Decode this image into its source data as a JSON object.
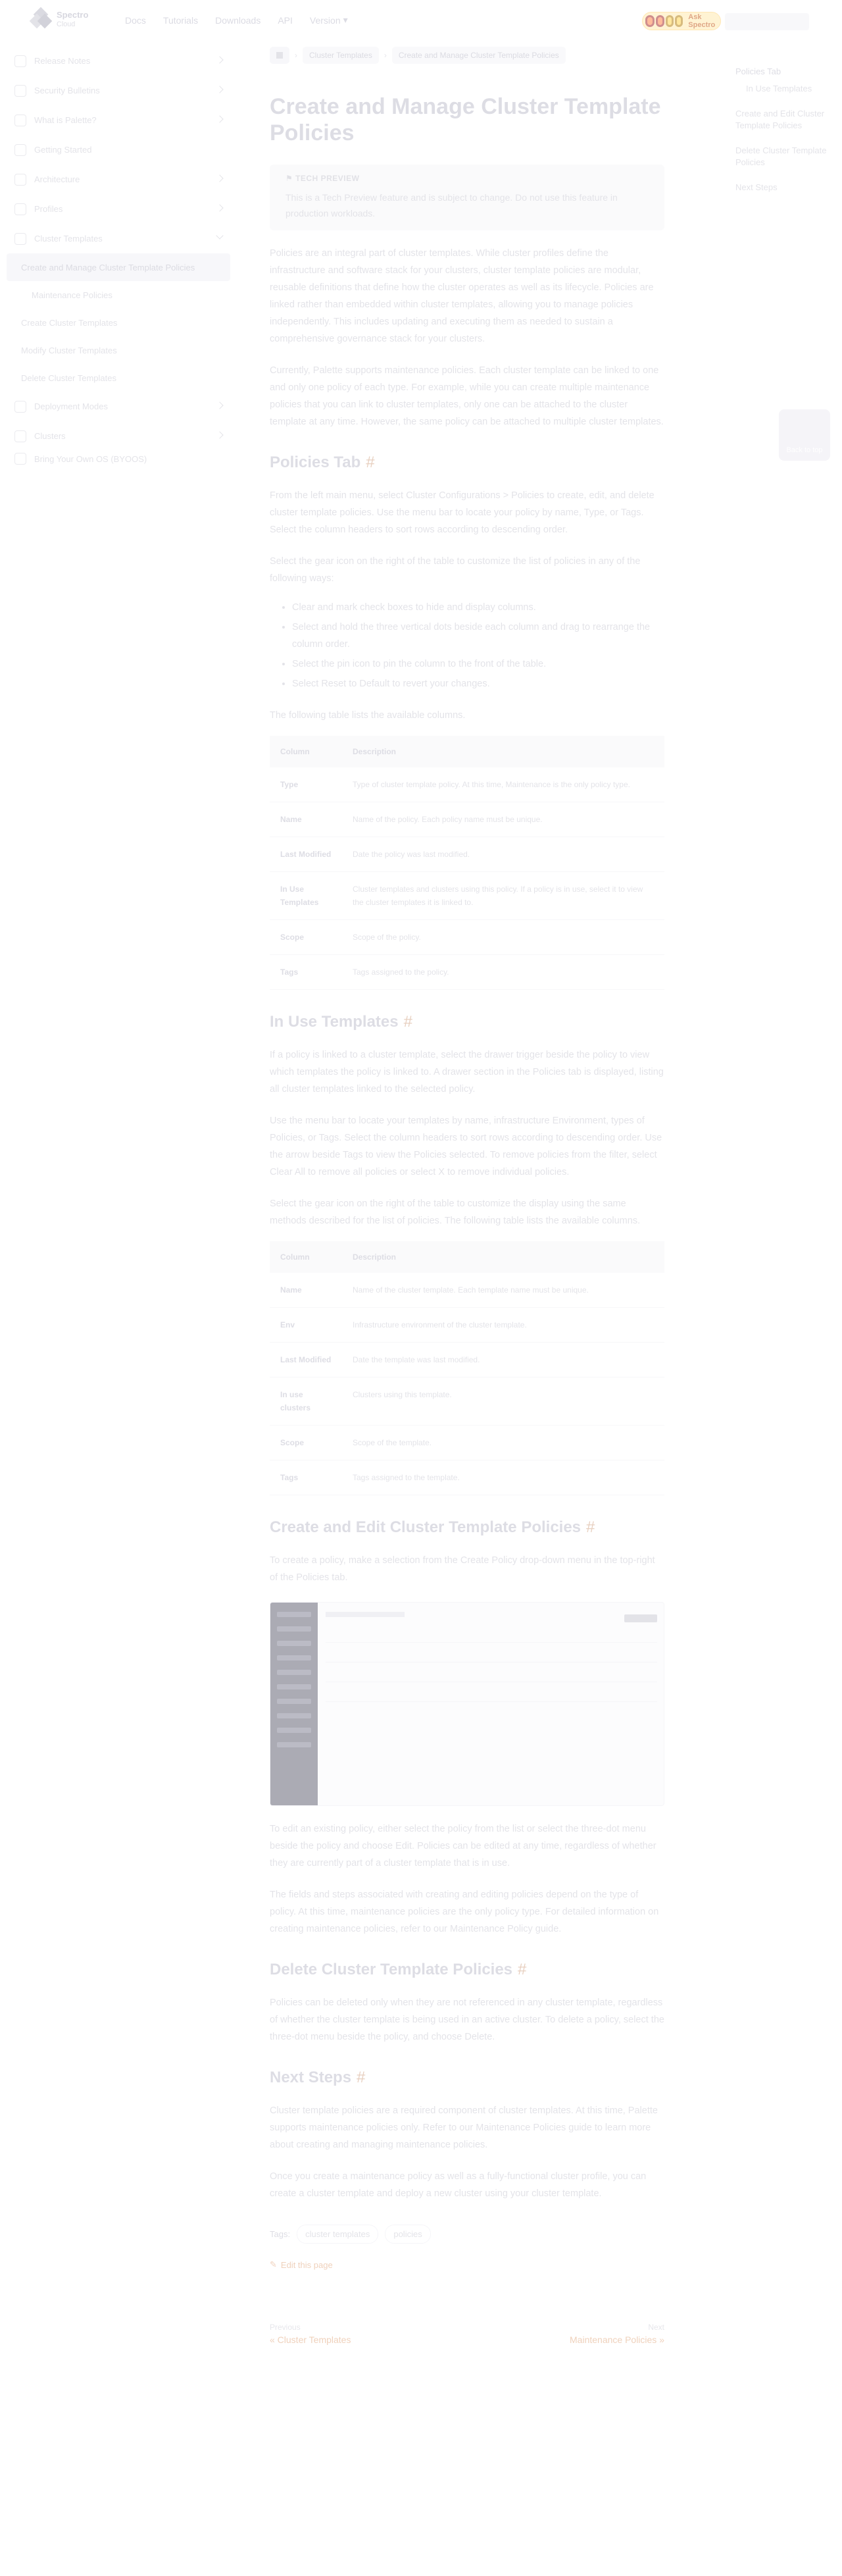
{
  "nav": {
    "logo_top": "Spectro",
    "logo_bottom": "Cloud",
    "links": [
      "Docs",
      "Tutorials",
      "Downloads",
      "API",
      "Version"
    ],
    "ask_label": "Ask Spectro"
  },
  "sidebar": {
    "items": [
      {
        "label": "Release Notes",
        "expand": true
      },
      {
        "label": "Security Bulletins",
        "expand": true
      },
      {
        "label": "What is Palette?",
        "expand": true
      },
      {
        "label": "Getting Started",
        "expand": false
      },
      {
        "label": "Architecture",
        "expand": true
      },
      {
        "label": "Profiles",
        "expand": true
      },
      {
        "label": "Cluster Templates",
        "expand": true,
        "open": true
      }
    ],
    "active_sub": "Create and Manage Cluster Template Policies",
    "subsub": "Maintenance Policies",
    "subs_after": [
      "Create Cluster Templates",
      "Modify Cluster Templates",
      "Delete Cluster Templates"
    ],
    "items_after": [
      {
        "label": "Deployment Modes",
        "expand": true
      },
      {
        "label": "Clusters",
        "expand": true
      },
      {
        "label": "Bring Your Own OS (BYOOS)",
        "expand": true
      }
    ]
  },
  "breadcrumb": {
    "items": [
      "Cluster Templates",
      "Create and Manage Cluster Template Policies"
    ]
  },
  "page": {
    "title": "Create and Manage Cluster Template Policies",
    "callout_title": "TECH PREVIEW",
    "callout_text": "This is a Tech Preview feature and is subject to change. Do not use this feature in production workloads.",
    "intro_1": "Policies are an integral part of cluster templates. While cluster profiles define the infrastructure and software stack for your clusters, cluster template policies are modular, reusable definitions that define how the cluster operates as well as its lifecycle. Policies are linked rather than embedded within cluster templates, allowing you to manage policies independently. This includes updating and executing them as needed to sustain a comprehensive governance stack for your clusters.",
    "intro_2": "Currently, Palette supports maintenance policies. Each cluster template can be linked to one and only one policy of each type. For example, while you can create multiple maintenance policies that you can link to cluster templates, only one can be attached to the cluster template at any time. However, the same policy can be attached to multiple cluster templates.",
    "h_policies_tab": "Policies Tab",
    "policies_tab_1": "From the left main menu, select Cluster Configurations > Policies to create, edit, and delete cluster template policies. Use the menu bar to locate your policy by name, Type, or Tags. Select the column headers to sort rows according to descending order.",
    "policies_tab_2": "Select the gear icon on the right of the table to customize the list of policies in any of the following ways:",
    "bullets": [
      "Clear and mark check boxes to hide and display columns.",
      "Select and hold the three vertical dots beside each column and drag to rearrange the column order.",
      "Select the pin icon to pin the column to the front of the table.",
      "Select Reset to Default to revert your changes."
    ],
    "columns_intro": "The following table lists the available columns.",
    "table1_headers": [
      "Column",
      "Description"
    ],
    "table1_rows": [
      [
        "Type",
        "Type of cluster template policy. At this time, Maintenance is the only policy type."
      ],
      [
        "Name",
        "Name of the policy. Each policy name must be unique."
      ],
      [
        "Last Modified",
        "Date the policy was last modified."
      ],
      [
        "In Use Templates",
        "Cluster templates and clusters using this policy. If a policy is in use, select it to view the cluster templates it is linked to."
      ],
      [
        "Scope",
        "Scope of the policy."
      ],
      [
        "Tags",
        "Tags assigned to the policy."
      ]
    ],
    "h_in_use": "In Use Templates",
    "in_use_1": "If a policy is linked to a cluster template, select the drawer trigger beside the policy to view which templates the policy is linked to. A drawer section in the Policies tab is displayed, listing all cluster templates linked to the selected policy.",
    "in_use_2": "Use the menu bar to locate your templates by name, infrastructure Environment, types of Policies, or Tags. Select the column headers to sort rows according to descending order. Use the arrow beside Tags to view the Policies selected. To remove policies from the filter, select Clear All to remove all policies or select X to remove individual policies.",
    "in_use_3": "Select the gear icon on the right of the table to customize the display using the same methods described for the list of policies. The following table lists the available columns.",
    "table2_headers": [
      "Column",
      "Description"
    ],
    "table2_rows": [
      [
        "Name",
        "Name of the cluster template. Each template name must be unique."
      ],
      [
        "Env",
        "Infrastructure environment of the cluster template."
      ],
      [
        "Last Modified",
        "Date the template was last modified."
      ],
      [
        "In use clusters",
        "Clusters using this template."
      ],
      [
        "Scope",
        "Scope of the template."
      ],
      [
        "Tags",
        "Tags assigned to the template."
      ]
    ],
    "h_create_edit": "Create and Edit Cluster Template Policies",
    "create_1": "To create a policy, make a selection from the Create Policy drop-down menu in the top-right of the Policies tab.",
    "create_2": "To edit an existing policy, either select the policy from the list or select the three-dot menu beside the policy and choose Edit. Policies can be edited at any time, regardless of whether they are currently part of a cluster template that is in use.",
    "create_3": "The fields and steps associated with creating and editing policies depend on the type of policy. At this time, maintenance policies are the only policy type. For detailed information on creating maintenance policies, refer to our Maintenance Policy guide.",
    "h_delete": "Delete Cluster Template Policies",
    "delete_1": "Policies can be deleted only when they are not referenced in any cluster template, regardless of whether the cluster template is being used in an active cluster. To delete a policy, select the three-dot menu beside the policy, and choose Delete.",
    "h_next": "Next Steps",
    "next_1": "Cluster template policies are a required component of cluster templates. At this time, Palette supports maintenance policies only. Refer to our Maintenance Policies guide to learn more about creating and managing maintenance policies.",
    "next_2": "Once you create a maintenance policy as well as a fully-functional cluster profile, you can create a cluster template and deploy a new cluster using your cluster template.",
    "tags_label": "Tags:",
    "tags": [
      "cluster templates",
      "policies"
    ],
    "edit_link": "Edit this page",
    "prev_label": "Previous",
    "prev_value": "« Cluster Templates",
    "next_label": "Next",
    "next_value": "Maintenance Policies »"
  },
  "toc": {
    "items": [
      "Policies Tab",
      "In Use Templates",
      "Create and Edit Cluster Template Policies",
      "Delete Cluster Template Policies",
      "Next Steps"
    ],
    "backtop": "Back to top"
  }
}
